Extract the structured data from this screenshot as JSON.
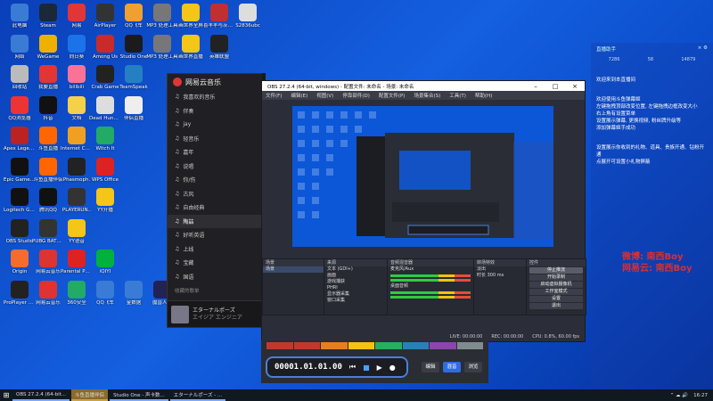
{
  "desktop": {
    "icons": [
      {
        "label": "此电脑",
        "color": "#3a7bd5"
      },
      {
        "label": "Steam",
        "color": "#1b2838"
      },
      {
        "label": "网易",
        "color": "#e03636"
      },
      {
        "label": "AirPlayer",
        "color": "#333"
      },
      {
        "label": "QQ飞车",
        "color": "#f0a030"
      },
      {
        "label": "MP3 处理工具",
        "color": "#777"
      },
      {
        "label": "画世界全屏",
        "color": "#f5c518"
      },
      {
        "label": "喜羊羊与灰太狼",
        "color": "#c03030"
      },
      {
        "label": "S2836ubc",
        "color": "#ddd"
      },
      {
        "label": "网络",
        "color": "#3a7bd5"
      },
      {
        "label": "WeGame",
        "color": "#f0b000"
      },
      {
        "label": "向日葵",
        "color": "#1a73e8"
      },
      {
        "label": "Among Us",
        "color": "#c92a2a"
      },
      {
        "label": "Studio One",
        "color": "#1b1b1b"
      },
      {
        "label": "MP3 处理工具",
        "color": "#777"
      },
      {
        "label": "画世界直播",
        "color": "#f5c518"
      },
      {
        "label": "英雄联盟",
        "color": "#222"
      },
      {
        "label": "回收站",
        "color": "#bbb"
      },
      {
        "label": "我要直播",
        "color": "#e03636"
      },
      {
        "label": "bilibili",
        "color": "#fb7299"
      },
      {
        "label": "Crab Game",
        "color": "#222"
      },
      {
        "label": "TeamSpeak",
        "color": "#2580c3"
      },
      {
        "label": "QQ浏览器",
        "color": "#e33"
      },
      {
        "label": "抖音",
        "color": "#111"
      },
      {
        "label": "文档",
        "color": "#f5d04a"
      },
      {
        "label": "Dead Hunger",
        "color": "#ddd"
      },
      {
        "label": "伴侣直播",
        "color": "#eee"
      },
      {
        "label": "Apex Legends",
        "color": "#b22"
      },
      {
        "label": "斗鱼直播",
        "color": "#f60"
      },
      {
        "label": "Internet Cafe Si.",
        "color": "#f0a020"
      },
      {
        "label": "Witch It",
        "color": "#2a6"
      },
      {
        "label": "Epic Games Launcher",
        "color": "#111"
      },
      {
        "label": "斗鱼直播伴侣",
        "color": "#f60"
      },
      {
        "label": "Phasmoph.",
        "color": "#222"
      },
      {
        "label": "WPS Office",
        "color": "#d22"
      },
      {
        "label": "Logitech G HUB",
        "color": "#111"
      },
      {
        "label": "腾讯QQ",
        "color": "#111"
      },
      {
        "label": "PLAYERUN..",
        "color": "#333"
      },
      {
        "label": "YY开播",
        "color": "#f5c518"
      },
      {
        "label": "OBS Studio",
        "color": "#222"
      },
      {
        "label": "PUBG BATTLEGR.",
        "color": "#333"
      },
      {
        "label": "YY语音",
        "color": "#f5c518"
      },
      {
        "label": "Origin",
        "color": "#f56c2d"
      },
      {
        "label": "网易云音乐",
        "color": "#d33"
      },
      {
        "label": "Parental Party",
        "color": "#d22"
      },
      {
        "label": "iQIYI",
        "color": "#00b140"
      },
      {
        "label": "ProPlayer 64 bit",
        "color": "#222"
      },
      {
        "label": "网易云音乐",
        "color": "#d33"
      },
      {
        "label": "360安全",
        "color": "#2a6"
      },
      {
        "label": "QQ飞车",
        "color": "#3a7bd5"
      },
      {
        "label": "金数据",
        "color": "#3a7bd5"
      },
      {
        "label": "魔兽人间",
        "color": "#225"
      },
      {
        "label": "PICO-PARK",
        "color": "#ddd"
      }
    ]
  },
  "netease": {
    "title": "网易云音乐",
    "items": [
      {
        "label": "我喜欢的音乐"
      },
      {
        "label": "伴奏"
      },
      {
        "label": "jay"
      },
      {
        "label": "轻音乐"
      },
      {
        "label": "嘉年"
      },
      {
        "label": "说唱"
      },
      {
        "label": "你/伤"
      },
      {
        "label": "古风"
      },
      {
        "label": "自由经典"
      },
      {
        "label": "陶喆"
      },
      {
        "label": "好听英语"
      },
      {
        "label": "上线"
      },
      {
        "label": "宝藏"
      },
      {
        "label": "国语"
      },
      {
        "label": "热歌榜"
      }
    ],
    "section": "收藏的歌单",
    "now_playing": {
      "title": "エターナルポーズ",
      "artist": "エイジア エンジニア",
      "time": "02:21 / 04:08"
    }
  },
  "obs": {
    "title": "OBS 27.2.4 (64-bit, windows) - 配置文件: 未命名 - 场景: 未命名",
    "menu": [
      "文件(F)",
      "编辑(E)",
      "视图(V)",
      "停靠部件(D)",
      "配置文件(P)",
      "场景集合(S)",
      "工具(T)",
      "帮助(H)"
    ],
    "panels": {
      "scenes": {
        "header": "场景",
        "rows": [
          "场景"
        ]
      },
      "sources": {
        "header": "来源",
        "rows": [
          "文本 (GDI+)",
          "画面",
          "游戏捕获",
          "PHRI",
          "显示器采集",
          "窗口采集"
        ]
      },
      "mixer": {
        "header": "音频混音器",
        "rows": [
          "麦克风/Aux",
          "桌面音频"
        ]
      },
      "transitions": {
        "header": "转场特效",
        "rows": [
          "淡出",
          "时长 300 ms"
        ]
      },
      "controls": {
        "header": "控件",
        "buttons": [
          "停止推流",
          "开始录制",
          "启动虚拟摄像机",
          "工作室模式",
          "设置",
          "退出"
        ]
      }
    },
    "status": {
      "live": "LIVE: 00:00:00",
      "rec": "REC: 00:00:00",
      "cpu": "CPU: 0.8%, 60.00 fps"
    }
  },
  "transport": {
    "time": "00001.01.01.00",
    "modes": [
      "编辑",
      "混音",
      "浏览"
    ]
  },
  "chat": {
    "header": "直播助手",
    "stats": [
      "7286",
      "58",
      "14879"
    ],
    "lines": [
      {
        "text": "欢迎来到本直播间",
        "color": "#fff"
      },
      {
        "text": "欢迎使用斗鱼弹幕姬",
        "color": "#fff"
      },
      {
        "text": "左键拖拽顶部改变位置, 左键拖拽边框改变大小",
        "color": "#fff"
      },
      {
        "text": "右上角有设置菜单",
        "color": "#fff"
      },
      {
        "text": "设置展示弹幕, 更换视频, 粉丝牌升级等",
        "color": "#fff"
      },
      {
        "text": "添加弹幕姬手成功",
        "color": "#fff"
      },
      {
        "text": "设置展示你收到的礼物、道具、贵族开通、钻粉开通",
        "color": "#fff"
      },
      {
        "text": "点展开可设置小礼物屏蔽",
        "color": "#fff"
      }
    ],
    "watermark": [
      "微博: 南西Boy",
      "网易云: 南西Boy"
    ]
  },
  "taskbar": {
    "tasks": [
      {
        "label": "OBS 27.2.4 (64-bit...",
        "active": true
      },
      {
        "label": "斗鱼直播伴侣",
        "active": false
      },
      {
        "label": "Studio One - 声卡数...",
        "active": true
      },
      {
        "label": "エターナルポーズ - ...",
        "active": true
      }
    ],
    "clock": "16:27"
  }
}
